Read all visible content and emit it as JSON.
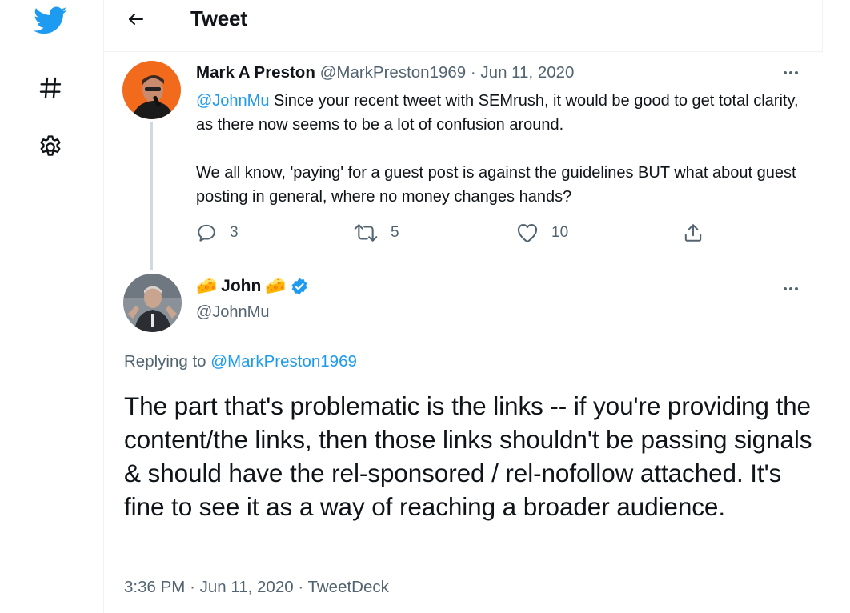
{
  "header": {
    "title": "Tweet"
  },
  "original_tweet": {
    "author_name": "Mark A Preston",
    "author_handle": "@MarkPreston1969",
    "separator": "·",
    "date": "Jun 11, 2020",
    "mention": "@JohnMu",
    "text_part1": " Since your recent tweet with SEMrush, it would be good to get total clarity, as there now seems to be a lot of confusion around.",
    "text_part2": "We all know, 'paying' for a guest post is against the guidelines BUT what about guest posting in general, where no money changes hands?",
    "reply_count": "3",
    "retweet_count": "5",
    "like_count": "10"
  },
  "reply_tweet": {
    "author_name": "John",
    "author_emoji": "🧀",
    "author_handle": "@JohnMu",
    "replying_prefix": "Replying to ",
    "replying_to": "@MarkPreston1969",
    "text": "The part that's problematic is the links -- if you're providing the content/the links, then those links shouldn't be passing signals & should have the rel-sponsored / rel-nofollow attached. It's fine to see it as a way of reaching a broader audience.",
    "time": "3:36 PM",
    "separator": "·",
    "date": "Jun 11, 2020",
    "source": "TweetDeck"
  },
  "colors": {
    "brand": "#1d9bf0",
    "text": "#0f1419",
    "secondary": "#536471",
    "border": "#eff3f4"
  },
  "icons": {
    "logo": "twitter-bird-icon",
    "explore": "hashtag-icon",
    "settings": "gear-icon",
    "back": "arrow-left-icon",
    "more": "more-horizontal-icon",
    "reply": "reply-icon",
    "retweet": "retweet-icon",
    "like": "heart-icon",
    "share": "share-icon",
    "verified": "verified-badge-icon"
  }
}
